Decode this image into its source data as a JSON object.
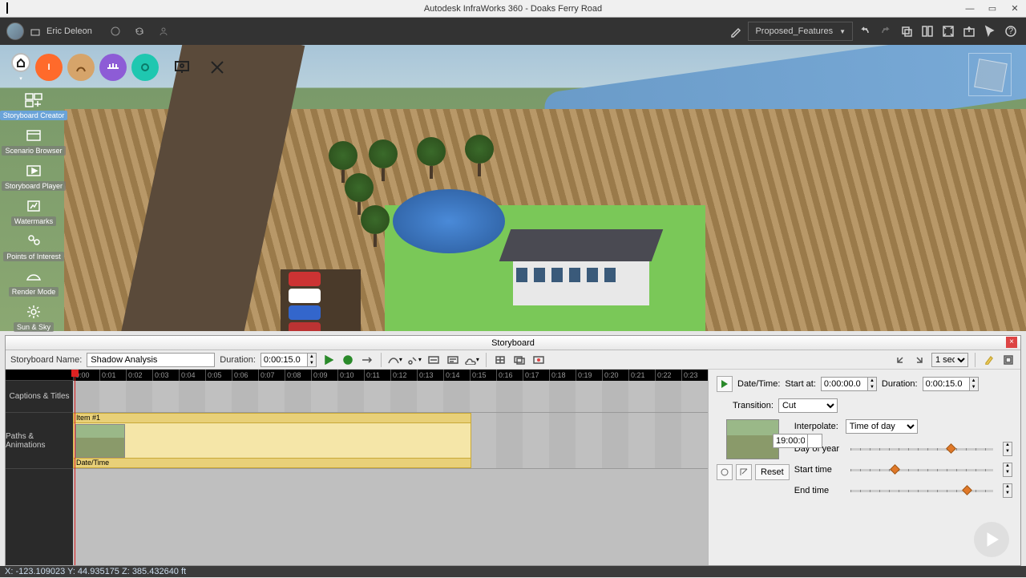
{
  "title": "Autodesk InfraWorks 360 - Doaks Ferry Road",
  "user": {
    "name": "Eric Deleon"
  },
  "proposal": {
    "label": "Proposed_Features"
  },
  "leftTools": [
    {
      "id": "storyboard-creator",
      "label": "Storyboard Creator",
      "active": true
    },
    {
      "id": "scenario-browser",
      "label": "Scenario Browser"
    },
    {
      "id": "storyboard-player",
      "label": "Storyboard Player"
    },
    {
      "id": "watermarks",
      "label": "Watermarks"
    },
    {
      "id": "points-of-interest",
      "label": "Points of Interest"
    },
    {
      "id": "render-mode",
      "label": "Render Mode"
    },
    {
      "id": "sun-sky",
      "label": "Sun & Sky"
    }
  ],
  "storyboard": {
    "panelTitle": "Storyboard",
    "nameLabel": "Storyboard Name:",
    "name": "Shadow Analysis",
    "durationLabel": "Duration:",
    "duration": "0:00:15.0",
    "zoom": "1 sec",
    "tracks": {
      "captions": "Captions & Titles",
      "paths": "Paths & Animations"
    },
    "ticks": [
      "0:00",
      "0:01",
      "0:02",
      "0:03",
      "0:04",
      "0:05",
      "0:06",
      "0:07",
      "0:08",
      "0:09",
      "0:10",
      "0:11",
      "0:12",
      "0:13",
      "0:14",
      "0:15",
      "0:16",
      "0:17",
      "0:18",
      "0:19",
      "0:20",
      "0:21",
      "0:22",
      "0:23"
    ],
    "clip": {
      "title": "Item #1",
      "footer": "Date/Time"
    }
  },
  "props": {
    "dateTimeLabel": "Date/Time:",
    "dateTime": "Item #1",
    "startAtLabel": "Start at:",
    "startAt": "0:00:00.0",
    "durationLabel": "Duration:",
    "duration": "0:00:15.0",
    "transitionLabel": "Transition:",
    "transition": "Cut",
    "interpolateLabel": "Interpolate:",
    "interpolate": "Time of day",
    "dayOfYearLabel": "Day of year",
    "dayOfYear": "250",
    "startTimeLabel": "Start time",
    "startTime": "07:00:00",
    "endTimeLabel": "End time",
    "endTime": "19:00:00",
    "reset": "Reset"
  },
  "status": "X: -123.109023  Y: 44.935175  Z: 385.432640 ft"
}
